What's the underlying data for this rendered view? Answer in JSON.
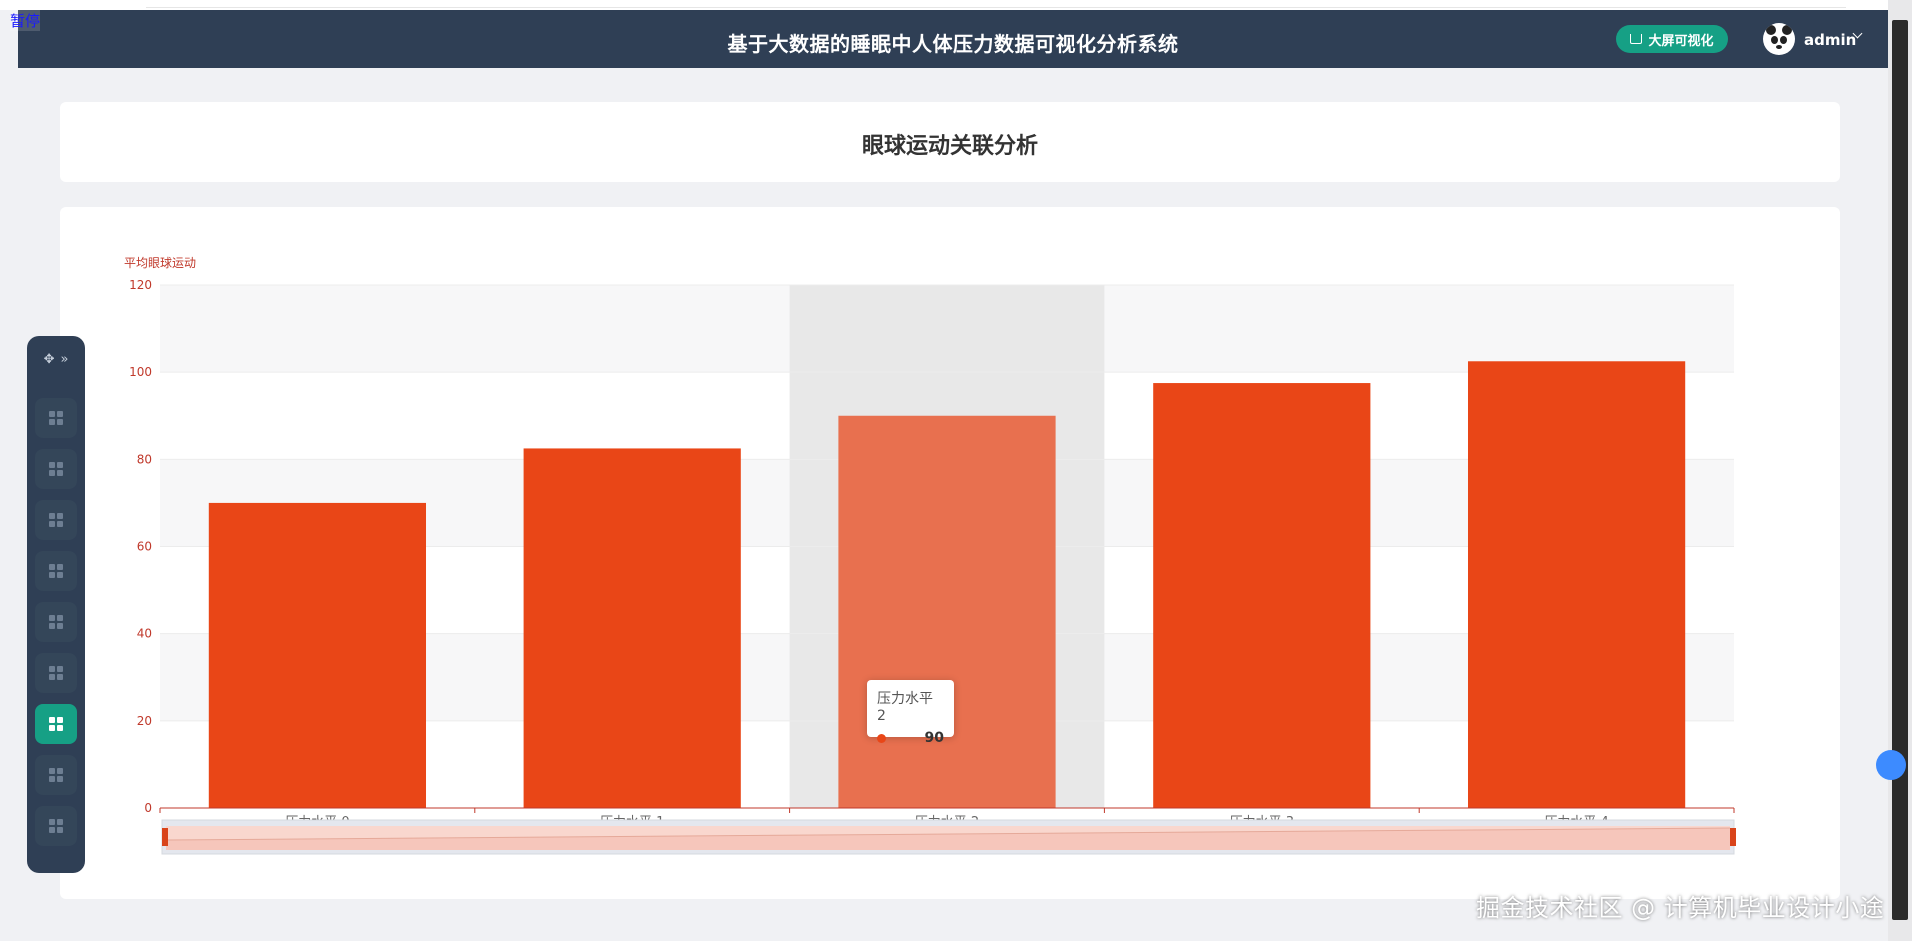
{
  "overlay": {
    "pause_label": "暂停"
  },
  "header": {
    "title": "基于大数据的睡眠中人体压力数据可视化分析系统",
    "bigscreen_label": "大屏可视化",
    "user_name": "admin"
  },
  "page": {
    "title": "眼球运动关联分析"
  },
  "sidebar": {
    "items": [
      {
        "icon": "grid-icon",
        "active": false
      },
      {
        "icon": "grid-icon",
        "active": false
      },
      {
        "icon": "grid-icon",
        "active": false
      },
      {
        "icon": "grid-icon",
        "active": false
      },
      {
        "icon": "grid-icon",
        "active": false
      },
      {
        "icon": "grid-icon",
        "active": false
      },
      {
        "icon": "grid-icon",
        "active": true
      },
      {
        "icon": "grid-icon",
        "active": false
      },
      {
        "icon": "grid-icon",
        "active": false
      }
    ]
  },
  "chart_data": {
    "type": "bar",
    "categories": [
      "压力水平 0",
      "压力水平 1",
      "压力水平 2",
      "压力水平 3",
      "压力水平 4"
    ],
    "values": [
      70,
      82.5,
      90,
      97.5,
      102.5
    ],
    "ylabel": "平均眼球运动",
    "ylim": [
      0,
      120
    ],
    "yticks": [
      0,
      20,
      40,
      60,
      80,
      100,
      120
    ],
    "highlighted_index": 2,
    "grid": true,
    "bar_color": "#e94617",
    "highlight_color": "#e8704f",
    "tooltip": {
      "label": "压力水平 2",
      "value": "90"
    },
    "datazoom": {
      "range": [
        0,
        100
      ]
    }
  },
  "watermark": "掘金技术社区 @ 计算机毕业设计小途",
  "colors": {
    "header_bg": "#2f3f55",
    "accent": "#16a085",
    "bar": "#e94617"
  }
}
